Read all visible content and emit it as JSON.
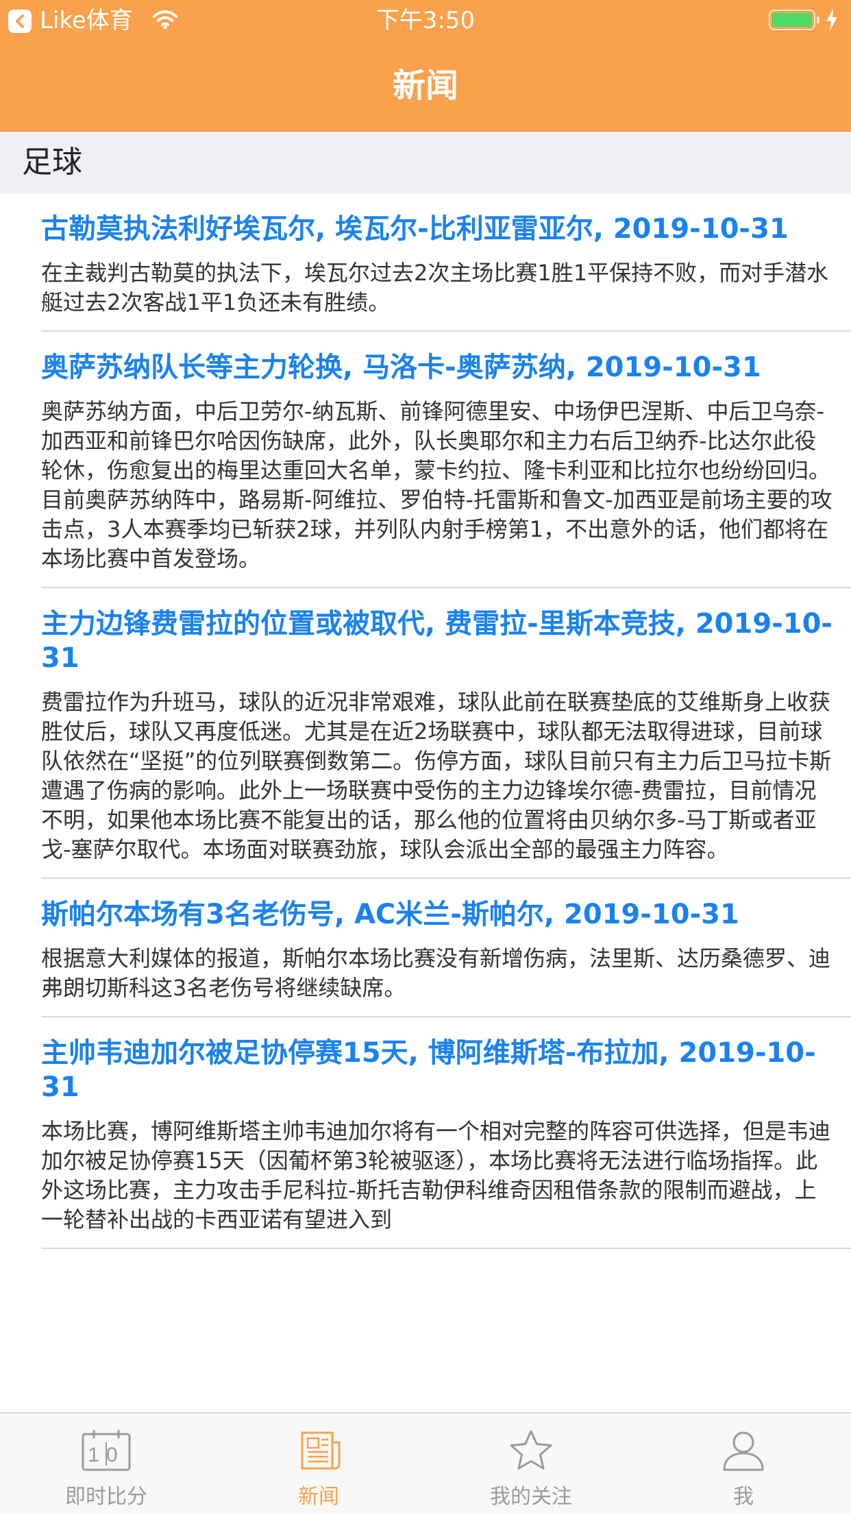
{
  "status_bar": {
    "back_app": "Like体育",
    "time": "下午3:50",
    "battery_level": 1.0,
    "icons": [
      "back-arrow-icon",
      "wifi-icon",
      "battery-icon",
      "charging-icon"
    ]
  },
  "nav": {
    "title": "新闻"
  },
  "section": {
    "title": "足球"
  },
  "news": [
    {
      "title": "古勒莫执法利好埃瓦尔, 埃瓦尔-比利亚雷亚尔, 2019-10-31",
      "body": "在主裁判古勒莫的执法下，埃瓦尔过去2次主场比赛1胜1平保持不败，而对手潜水艇过去2次客战1平1负还未有胜绩。"
    },
    {
      "title": "奥萨苏纳队长等主力轮换, 马洛卡-奥萨苏纳, 2019-10-31",
      "body": "奥萨苏纳方面，中后卫劳尔-纳瓦斯、前锋阿德里安、中场伊巴涅斯、中后卫乌奈-加西亚和前锋巴尔哈因伤缺席，此外，队长奥耶尔和主力右后卫纳乔-比达尔此役轮休，伤愈复出的梅里达重回大名单，蒙卡约拉、隆卡利亚和比拉尔也纷纷回归。目前奥萨苏纳阵中，路易斯-阿维拉、罗伯特-托雷斯和鲁文-加西亚是前场主要的攻击点，3人本赛季均已斩获2球，并列队内射手榜第1，不出意外的话，他们都将在本场比赛中首发登场。"
    },
    {
      "title": "主力边锋费雷拉的位置或被取代, 费雷拉-里斯本竞技, 2019-10-31",
      "body": "费雷拉作为升班马，球队的近况非常艰难，球队此前在联赛垫底的艾维斯身上收获胜仗后，球队又再度低迷。尤其是在近2场联赛中，球队都无法取得进球，目前球队依然在“坚挺”的位列联赛倒数第二。伤停方面，球队目前只有主力后卫马拉卡斯遭遇了伤病的影响。此外上一场联赛中受伤的主力边锋埃尔德-费雷拉，目前情况不明，如果他本场比赛不能复出的话，那么他的位置将由贝纳尔多-马丁斯或者亚戈-塞萨尔取代。本场面对联赛劲旅，球队会派出全部的最强主力阵容。"
    },
    {
      "title": "斯帕尔本场有3名老伤号, AC米兰-斯帕尔, 2019-10-31",
      "body": "根据意大利媒体的报道，斯帕尔本场比赛没有新增伤病，法里斯、达历桑德罗、迪弗朗切斯科这3名老伤号将继续缺席。"
    },
    {
      "title": "主帅韦迪加尔被足协停赛15天, 博阿维斯塔-布拉加, 2019-10-31",
      "body": "本场比赛，博阿维斯塔主帅韦迪加尔将有一个相对完整的阵容可供选择，但是韦迪加尔被足协停赛15天（因葡杯第3轮被驱逐），本场比赛将无法进行临场指挥。此外这场比赛，主力攻击手尼科拉-斯托吉勒伊科维奇因租借条款的限制而避战，上一轮替补出战的卡西亚诺有望进入到"
    }
  ],
  "tabbar": {
    "tabs": [
      {
        "label": "即时比分",
        "icon": "calendar-score-icon"
      },
      {
        "label": "新闻",
        "icon": "newspaper-icon"
      },
      {
        "label": "我的关注",
        "icon": "star-icon"
      },
      {
        "label": "我",
        "icon": "person-icon"
      }
    ],
    "active_index": 1,
    "active_color": "#f9a14c",
    "inactive_color": "#9a9a9a"
  },
  "colors": {
    "header": "#f9a14c",
    "title_link": "#1a82f0",
    "section_bg": "#efeff4"
  },
  "calendar_digits": "10"
}
